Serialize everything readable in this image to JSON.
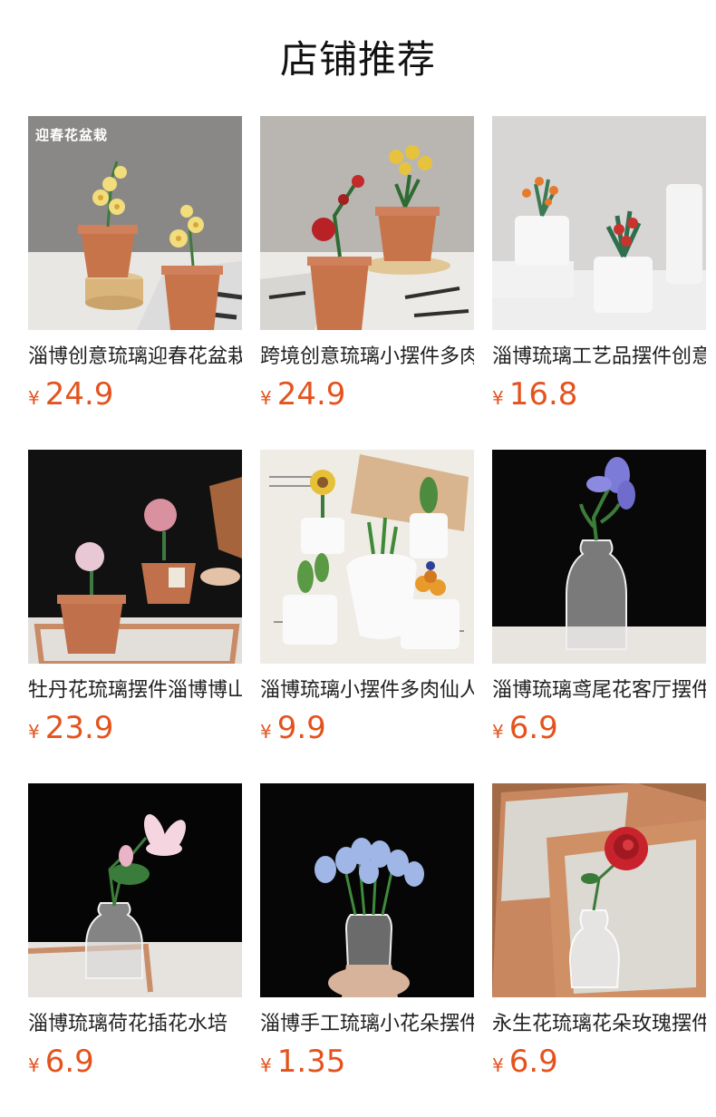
{
  "header": {
    "title": "店铺推荐"
  },
  "products": [
    {
      "badge": "迎春花盆栽",
      "name": "淄博创意琉璃迎春花盆栽",
      "currency": "¥",
      "price": "24.9",
      "image_icon": "yellow-flower-pots-image"
    },
    {
      "name": "跨境创意琉璃小摆件多肉",
      "currency": "¥",
      "price": "24.9",
      "image_icon": "red-yellow-flower-pots-image"
    },
    {
      "name": "淄博琉璃工艺品摆件创意",
      "currency": "¥",
      "price": "16.8",
      "image_icon": "orange-flower-white-pots-image"
    },
    {
      "name": "牡丹花琉璃摆件淄博博山",
      "currency": "¥",
      "price": "23.9",
      "image_icon": "peony-pots-image"
    },
    {
      "name": "淄博琉璃小摆件多肉仙人掌",
      "currency": "¥",
      "price": "9.9",
      "image_icon": "succulent-pots-image"
    },
    {
      "name": "淄博琉璃鸢尾花客厅摆件",
      "currency": "¥",
      "price": "6.9",
      "image_icon": "iris-vase-image"
    },
    {
      "name": "淄博琉璃荷花插花水培",
      "currency": "¥",
      "price": "6.9",
      "image_icon": "lotus-vase-image"
    },
    {
      "name": "淄博手工琉璃小花朵摆件",
      "currency": "¥",
      "price": "1.35",
      "image_icon": "blue-tulip-vase-image"
    },
    {
      "name": "永生花琉璃花朵玫瑰摆件",
      "currency": "¥",
      "price": "6.9",
      "image_icon": "rose-vase-image"
    }
  ]
}
